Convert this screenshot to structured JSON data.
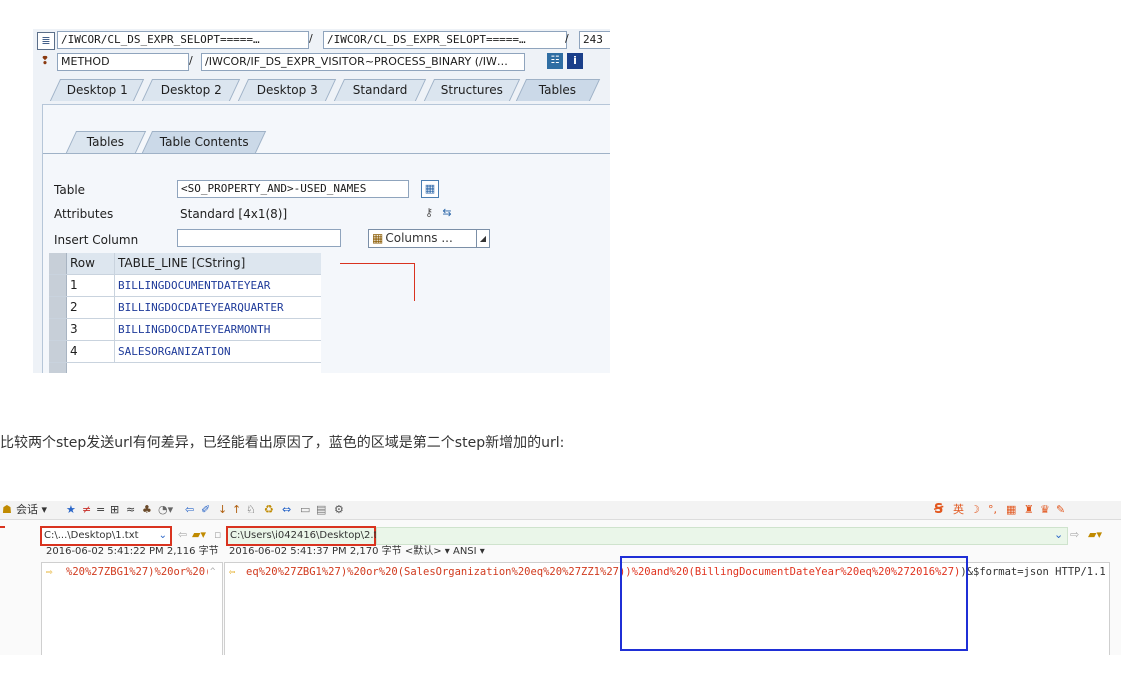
{
  "sap": {
    "row1": {
      "field1": "/IWCOR/CL_DS_EXPR_SELOPT=====…",
      "sep1": "/",
      "field2": "/IWCOR/CL_DS_EXPR_SELOPT=====…",
      "sep2": "/",
      "field3": "243"
    },
    "row2": {
      "field1": "METHOD",
      "sep": "/",
      "field2": "/IWCOR/IF_DS_EXPR_VISITOR~PROCESS_BINARY (/IW…"
    },
    "tabs": [
      "Desktop 1",
      "Desktop 2",
      "Desktop 3",
      "Standard",
      "Structures",
      "Tables"
    ],
    "subtabs": [
      "Tables",
      "Table Contents"
    ],
    "table_label": "Table",
    "table_value": "<SO_PROPERTY_AND>-USED_NAMES",
    "attributes_label": "Attributes",
    "attributes_value": "Standard [4x1(8)]",
    "insert_column_label": "Insert Column",
    "insert_column_value": "",
    "columns_button": "Columns ...",
    "grid": {
      "headers": [
        "Row",
        "TABLE_LINE [CString]"
      ],
      "rows": [
        {
          "num": "1",
          "val": "BILLINGDOCUMENTDATEYEAR"
        },
        {
          "num": "2",
          "val": "BILLINGDOCDATEYEARQUARTER"
        },
        {
          "num": "3",
          "val": "BILLINGDOCDATEYEARMONTH"
        },
        {
          "num": "4",
          "val": "SALESORGANIZATION"
        }
      ]
    }
  },
  "caption": "比较两个step发送url有何差异，已经能看出原因了，蓝色的区域是第二个step新增加的url:",
  "compare": {
    "toolbar_session": "会话 ▾",
    "left_path": "C:\\...\\Desktop\\1.txt",
    "right_path": "C:\\Users\\i042416\\Desktop\\2.txt",
    "left_info": "2016-06-02 5:41:22 PM  2,116 字节",
    "right_info": "2016-06-02 5:41:37 PM  2,170 字节  <默认> ▾  ANSI ▾",
    "left_text": "%20%27ZBG1%27)%20or%20(",
    "right_text_normal": "eq%20%27ZBG1%27)%20or%20(SalesOrganization%20eq%20%27ZZ1%27",
    "right_text_added": "))%20and%20(BillingDocumentDateYear%20eq%20%272016%27)",
    "right_text_tail": ")&$format=json HTTP/1.1",
    "ime_label": "英",
    "colors": {
      "red_box": "#d9331f",
      "blue_box": "#1f2fd6",
      "added_text": "#e0321e"
    }
  }
}
